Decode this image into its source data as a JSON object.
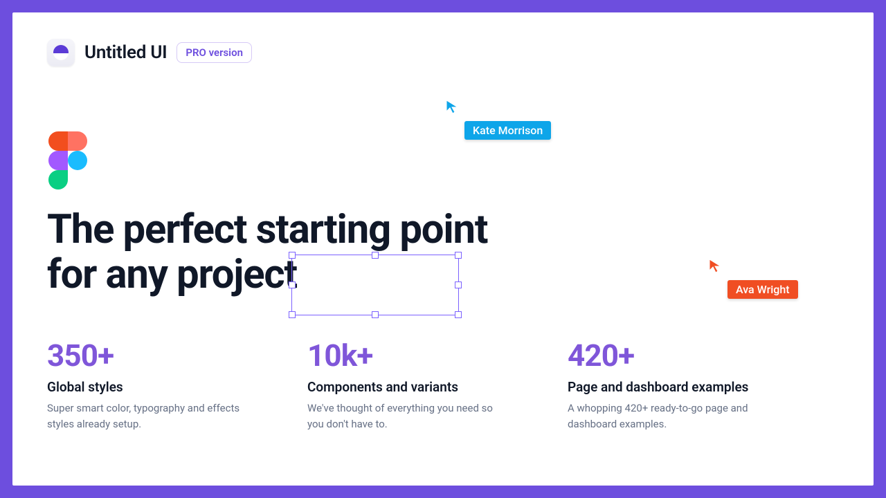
{
  "brand": {
    "name": "Untitled UI",
    "badge": "PRO version"
  },
  "headline": "The perfect starting point for any project",
  "selection_word": "project",
  "stats": [
    {
      "num": "350+",
      "title": "Global styles",
      "desc": "Super smart color, typography and effects styles already setup."
    },
    {
      "num": "10k+",
      "title": "Components and variants",
      "desc": "We've thought of everything you need so you don't have to."
    },
    {
      "num": "420+",
      "title": "Page and dashboard examples",
      "desc": "A whopping 420+ ready-to-go page and dashboard examples."
    }
  ],
  "cursors": {
    "blue": {
      "name": "Kate Morrison",
      "color": "#0EA5E9"
    },
    "orange": {
      "name": "Ava Wright",
      "color": "#F04E23"
    }
  }
}
